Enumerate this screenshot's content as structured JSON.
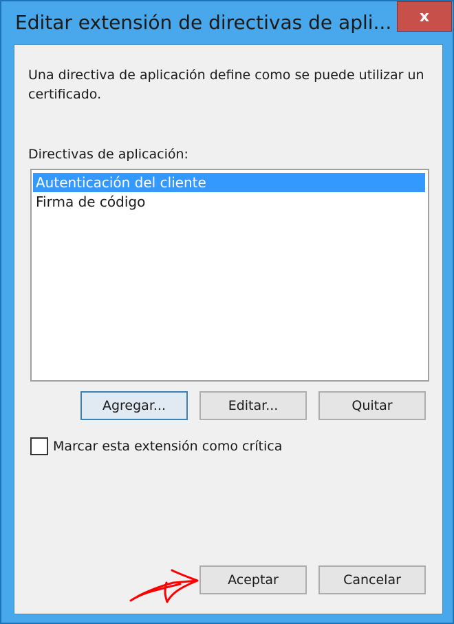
{
  "window": {
    "title": "Editar extensión de directivas de apli...",
    "close_glyph": "x"
  },
  "description": "Una directiva de aplicación define como se puede utilizar un certificado.",
  "list": {
    "label": "Directivas de aplicación:",
    "items": [
      {
        "label": "Autenticación del cliente",
        "selected": true
      },
      {
        "label": "Firma de código",
        "selected": false
      }
    ]
  },
  "buttons": {
    "add": "Agregar...",
    "edit": "Editar...",
    "remove": "Quitar",
    "ok": "Aceptar",
    "cancel": "Cancelar"
  },
  "critical_checkbox": {
    "label": "Marcar esta extensión como crítica",
    "checked": false
  },
  "colors": {
    "titlebar": "#49a8eb",
    "close": "#c7504b",
    "selection": "#3399ff",
    "annotation": "#ff0000"
  }
}
